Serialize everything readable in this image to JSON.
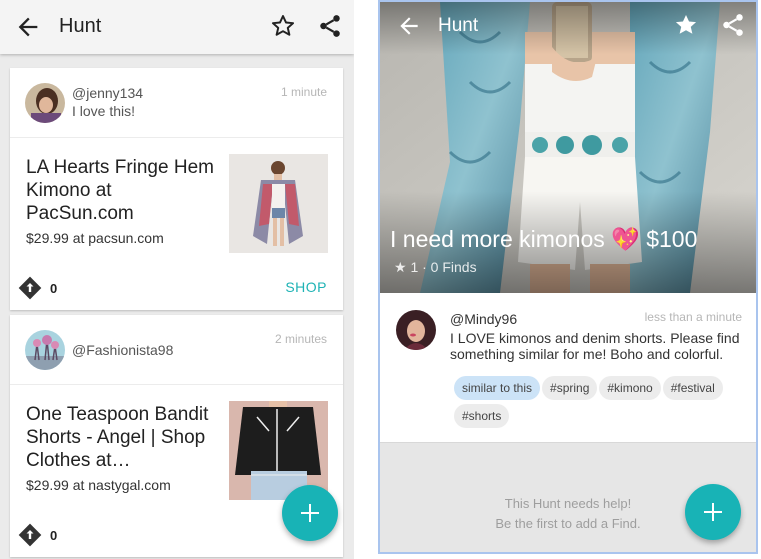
{
  "left": {
    "toolbar": {
      "title": "Hunt"
    },
    "cards": [
      {
        "user": "@jenny134",
        "comment": "I love this!",
        "time": "1 minute",
        "product_title": "LA Hearts Fringe Hem Kimono at PacSun.com",
        "price": "$29.99 at pacsun.com",
        "votes": "0",
        "shop_label": "SHOP"
      },
      {
        "user": "@Fashionista98",
        "time": "2 minutes",
        "product_title": "One Teaspoon Bandit Shorts - Angel | Shop Clothes at…",
        "price": "$29.99 at nastygal.com",
        "votes": "0"
      }
    ]
  },
  "right": {
    "toolbar": {
      "title": "Hunt"
    },
    "hunt": {
      "title": "I need more kimonos",
      "heart": "💖",
      "price": "$100",
      "meta": "★ 1 · 0 Finds"
    },
    "post": {
      "user": "@Mindy96",
      "time": "less than a minute",
      "text": "I LOVE kimonos and denim shorts. Please find something similar for me! Boho and colorful.",
      "tags": [
        "similar to this",
        "#spring",
        "#kimono",
        "#festival",
        "#shorts"
      ]
    },
    "help": {
      "line1": "This Hunt needs help!",
      "line2": "Be the first to add a Find."
    }
  },
  "colors": {
    "accent": "#18b3b6",
    "tag_active": "#cce3f7",
    "background": "#ebebeb"
  },
  "icons": [
    "arrow-left-icon",
    "star-outline-icon",
    "share-icon",
    "upvote-diamond-icon",
    "plus-icon",
    "star-filled-icon"
  ]
}
